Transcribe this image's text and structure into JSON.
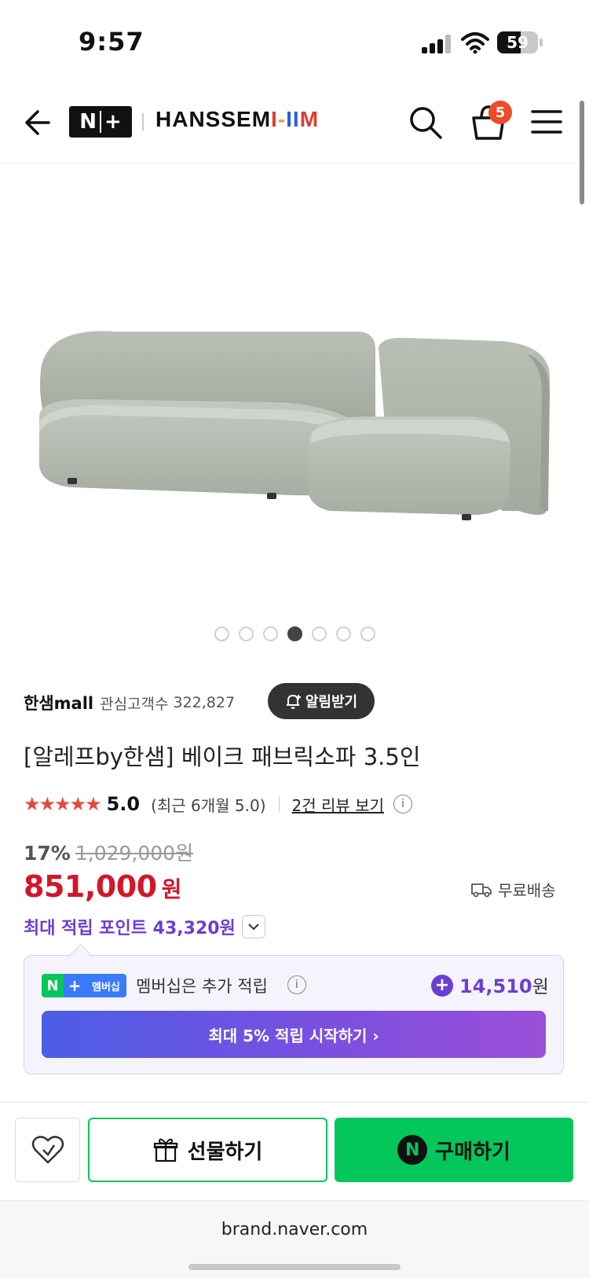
{
  "status": {
    "time": "9:57",
    "battery": "59"
  },
  "header": {
    "np_logo": {
      "n": "N",
      "plus": "+"
    },
    "brand_logo": [
      "HANSSEM",
      "I",
      "-",
      "I",
      "I",
      "M"
    ],
    "cart_count": "5"
  },
  "gallery": {
    "dots": 7,
    "active_index": 3
  },
  "seller": {
    "name": "한샘mall",
    "label": "관심고객수",
    "count": "322,827",
    "alarm_label": "알림받기"
  },
  "product": {
    "title": "[알레프by한샘] 베이크 패브릭소파 3.5인",
    "stars": "★★★★★",
    "score": "5.0",
    "recent": "(최근 6개월 5.0)",
    "review_link": "2건 리뷰 보기",
    "discount_pct": "17%",
    "original_price": "1,029,000원",
    "price": "851,000",
    "price_unit": "원",
    "shipping": "무료배송",
    "points": "최대 적립 포인트 43,320원"
  },
  "membership": {
    "badge_n": "N",
    "badge_plus": "+",
    "badge_label": "멤버십",
    "text": "멤버십은 추가 적립",
    "points": "14,510",
    "points_unit": "원",
    "cta": "최대 5% 적립 시작하기 ›"
  },
  "actions": {
    "gift": "선물하기",
    "buy_n": "N",
    "buy": "구매하기"
  },
  "browser": {
    "url": "brand.naver.com"
  },
  "colors": {
    "price_red": "#d3162b",
    "points_purple": "#6b3fd2",
    "naver_green": "#03c75a",
    "star_red": "#e24b3b"
  }
}
